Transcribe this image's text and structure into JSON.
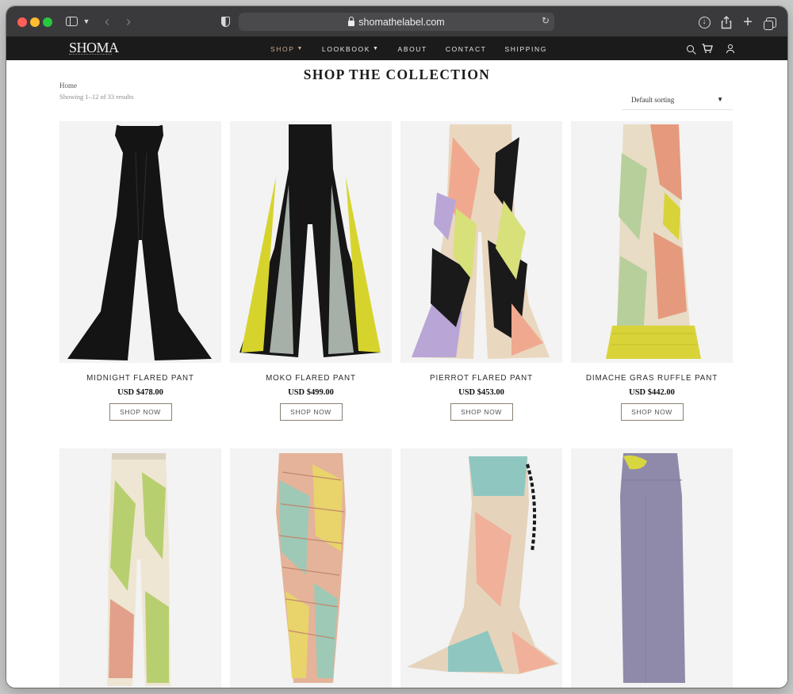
{
  "browser": {
    "url": "shomathelabel.com"
  },
  "header": {
    "logo": "SHOMA",
    "nav": [
      {
        "label": "SHOP",
        "has_dropdown": true,
        "active": true
      },
      {
        "label": "LOOKBOOK",
        "has_dropdown": true,
        "active": false
      },
      {
        "label": "ABOUT",
        "has_dropdown": false,
        "active": false
      },
      {
        "label": "CONTACT",
        "has_dropdown": false,
        "active": false
      },
      {
        "label": "SHIPPING",
        "has_dropdown": false,
        "active": false
      }
    ],
    "icons": [
      "search-icon",
      "cart-icon",
      "account-icon"
    ]
  },
  "main": {
    "title": "SHOP THE COLLECTION",
    "breadcrumb": "Home",
    "result_count": "Showing 1–12 of 33 results",
    "sort": {
      "selected": "Default sorting"
    }
  },
  "products": [
    {
      "name": "MIDNIGHT FLARED PANT",
      "price": "USD $478.00",
      "button": "SHOP NOW",
      "palette": [
        "#141414",
        "#1f1f1f"
      ]
    },
    {
      "name": "MOKO FLARED PANT",
      "price": "USD $499.00",
      "button": "SHOP NOW",
      "palette": [
        "#161616",
        "#d6d42c",
        "#a7b0a8"
      ]
    },
    {
      "name": "PIERROT FLARED PANT",
      "price": "USD $453.00",
      "button": "SHOP NOW",
      "palette": [
        "#e9d7bf",
        "#1a1a1a",
        "#b9a6d6",
        "#f0a98f",
        "#d8e07a"
      ]
    },
    {
      "name": "DIMACHE GRAS RUFFLE PANT",
      "price": "USD $442.00",
      "button": "SHOP NOW",
      "palette": [
        "#e8dcc5",
        "#e59a7e",
        "#b7cf9a",
        "#d9d33a"
      ]
    },
    {
      "name": "",
      "price": "",
      "button": "",
      "palette": [
        "#eee6d3",
        "#b8cf6f",
        "#e2a08a"
      ]
    },
    {
      "name": "",
      "price": "",
      "button": "",
      "palette": [
        "#e4b39a",
        "#9ec9b6",
        "#e8d46a"
      ]
    },
    {
      "name": "",
      "price": "",
      "button": "",
      "palette": [
        "#e6d3bb",
        "#8fc7c0",
        "#f0b09a"
      ]
    },
    {
      "name": "",
      "price": "",
      "button": "",
      "palette": [
        "#8f8aa9",
        "#d8d640"
      ]
    }
  ]
}
